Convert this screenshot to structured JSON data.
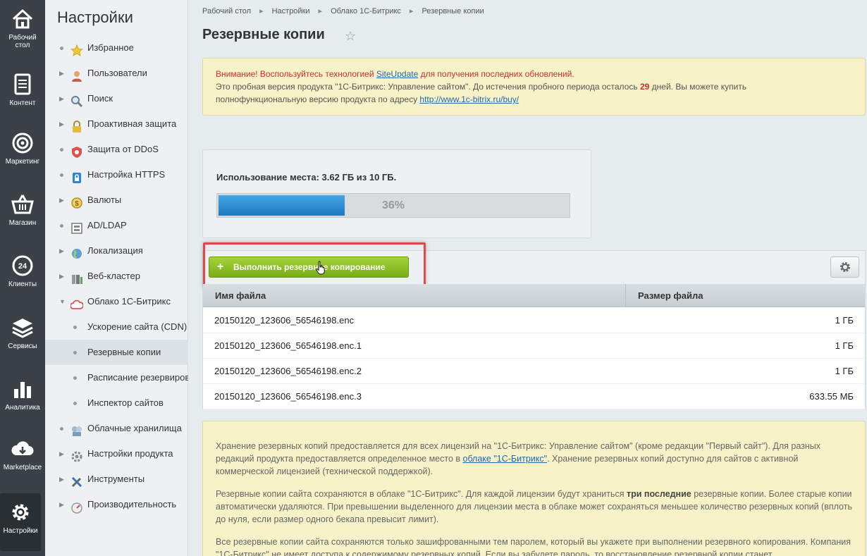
{
  "rail": {
    "items": [
      {
        "label": "Рабочий стол",
        "icon": "home-icon"
      },
      {
        "label": "Контент",
        "icon": "document-icon"
      },
      {
        "label": "Маркетинг",
        "icon": "target-icon"
      },
      {
        "label": "Магазин",
        "icon": "basket-icon"
      },
      {
        "label": "Клиенты",
        "icon": "clients-24-icon"
      },
      {
        "label": "Сервисы",
        "icon": "layers-icon"
      },
      {
        "label": "Аналитика",
        "icon": "bar-chart-icon"
      },
      {
        "label": "Marketplace",
        "icon": "cloud-download-icon"
      },
      {
        "label": "Настройки",
        "icon": "gear-icon"
      }
    ],
    "badge_24": "24"
  },
  "sidebar": {
    "title": "Настройки",
    "items": [
      {
        "label": "Избранное",
        "marker": "dot",
        "icon": "star-icon"
      },
      {
        "label": "Пользователи",
        "marker": "arrow",
        "icon": "user-icon"
      },
      {
        "label": "Поиск",
        "marker": "arrow",
        "icon": "magnifier-icon"
      },
      {
        "label": "Проактивная защита",
        "marker": "arrow",
        "icon": "lock-icon"
      },
      {
        "label": "Защита от DDoS",
        "marker": "dot",
        "icon": "shield-icon"
      },
      {
        "label": "Настройка HTTPS",
        "marker": "dot",
        "icon": "https-lock-icon"
      },
      {
        "label": "Валюты",
        "marker": "arrow",
        "icon": "coin-icon"
      },
      {
        "label": "AD/LDAP",
        "marker": "dot",
        "icon": "ldap-icon"
      },
      {
        "label": "Локализация",
        "marker": "arrow",
        "icon": "globe-icon"
      },
      {
        "label": "Веб-кластер",
        "marker": "arrow",
        "icon": "cluster-icon"
      },
      {
        "label": "Облако 1С-Битрикс",
        "marker": "arrow-down",
        "icon": "cloud-icon"
      },
      {
        "label": "Ускорение сайта (CDN)",
        "marker": "sub-dot"
      },
      {
        "label": "Резервные копии",
        "marker": "sub-dot",
        "selected": true
      },
      {
        "label": "Расписание резервиров",
        "marker": "sub-dot"
      },
      {
        "label": "Инспектор сайтов",
        "marker": "sub-dot"
      },
      {
        "label": "Облачные хранилища",
        "marker": "dot",
        "icon": "storage-icon"
      },
      {
        "label": "Настройки продукта",
        "marker": "arrow",
        "icon": "settings-icon"
      },
      {
        "label": "Инструменты",
        "marker": "arrow",
        "icon": "tools-icon"
      },
      {
        "label": "Производительность",
        "marker": "arrow",
        "icon": "performance-icon"
      }
    ]
  },
  "breadcrumb": [
    "Рабочий стол",
    "Настройки",
    "Облако 1С-Битрикс",
    "Резервные копии"
  ],
  "page": {
    "title": "Резервные копии",
    "star": "☆"
  },
  "notice": {
    "warn_before": "Внимание! Воспользуйтесь технологией ",
    "warn_link": "SiteUpdate",
    "warn_after": " для получения последних обновлений.",
    "line2_before": "Это пробная версия продукта \"1С-Битрикс: Управление сайтом\". До истечения пробного периода осталось ",
    "days": "29",
    "line2_after": " дней. Вы можете купить",
    "line3_before": "полнофункциональную версию продукта по адресу ",
    "line3_link": "http://www.1c-bitrix.ru/buy/"
  },
  "usage": {
    "label": "Использование места: 3.62 ГБ из 10 ГБ.",
    "percent_text": "36%",
    "fraction": 0.36
  },
  "toolbar": {
    "run_plus": "+",
    "run_label": "Выполнить резервное копирование"
  },
  "table": {
    "headers": {
      "name": "Имя файла",
      "size": "Размер файла"
    },
    "rows": [
      {
        "name": "20150120_123606_56546198.enc",
        "size": "1 ГБ"
      },
      {
        "name": "20150120_123606_56546198.enc.1",
        "size": "1 ГБ"
      },
      {
        "name": "20150120_123606_56546198.enc.2",
        "size": "1 ГБ"
      },
      {
        "name": "20150120_123606_56546198.enc.3",
        "size": "633.55 МБ"
      }
    ]
  },
  "info": {
    "p1_before": "Хранение резервных копий предоставляется для всех лицензий на \"1С-Битрикс: Управление сайтом\" (кроме редакции \"Первый сайт\"). Для разных редакций продукта предоставляется определенное место в ",
    "p1_link": "облаке \"1С-Битрикс\"",
    "p1_after": ". Хранение резервных копий доступно для сайтов с активной коммерческой лицензией (технической поддержкой).",
    "p2_before": "Резервные копии сайта сохраняются в облаке \"1С-Битрикс\". Для каждой лицензии будут храниться ",
    "p2_bold": "три последние",
    "p2_after": " резервные копии. Более старые копии автоматически удаляются. При превышении выделенного для лицензии места в облаке может сохраняться меньшее количество резервных копий (вплоть до нуля, если размер одного бекапа превысит лимит).",
    "p3": "Все резервные копии сайта сохраняются только зашифрованными тем паролем, который вы укажете при выполнении резервного копирования. Компания \"1С-Битрикс\" не имеет доступа к содержимому резервных копий. Если вы забудете пароль, то восстановление резервной копии станет"
  }
}
